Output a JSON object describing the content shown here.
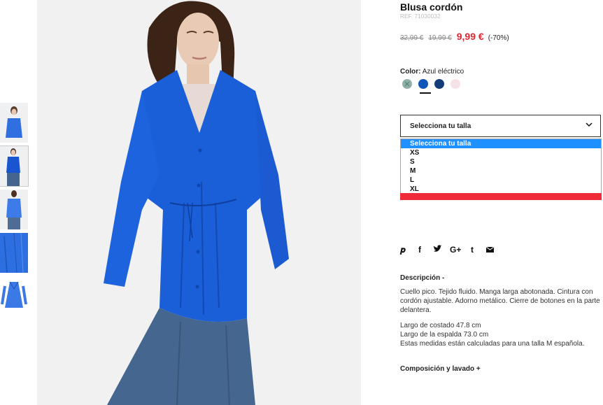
{
  "product": {
    "title": "Blusa cordón",
    "ref": "REF. 71030032",
    "old_price_1": "32,99 €",
    "old_price_2": "19,99 €",
    "price": "9,99 €",
    "discount": "(-70%)"
  },
  "color": {
    "label": "Color:",
    "value": "Azul eléctrico",
    "swatches": [
      "#8fb0a9",
      "#0d56b5",
      "#143c78",
      "#f6e3e8"
    ]
  },
  "size": {
    "placeholder": "Selecciona tu talla",
    "options": [
      "Selecciona tu talla",
      "XS",
      "S",
      "M",
      "L",
      "XL"
    ]
  },
  "social": [
    "pinterest-icon",
    "facebook-icon",
    "twitter-icon",
    "google-plus-icon",
    "tumblr-icon",
    "email-icon"
  ],
  "description": {
    "heading": "Descripción -",
    "text": "Cuello pico. Tejido fluido. Manga larga abotonada. Cintura con cordón ajustable. Adorno metálico. Cierre de botones en la parte delantera.",
    "measure_1": "Largo de costado 47.8 cm",
    "measure_2": "Largo de la espalda 73.0 cm",
    "measure_3": "Estas medidas están calculadas para una talla M española."
  },
  "composition": {
    "heading": "Composición y lavado +"
  },
  "colors": {
    "accent_red": "#e0262f",
    "select_blue": "#1e90ff",
    "bar_red": "#ef2b3a",
    "blouse_blue": "#1a5fd8"
  }
}
